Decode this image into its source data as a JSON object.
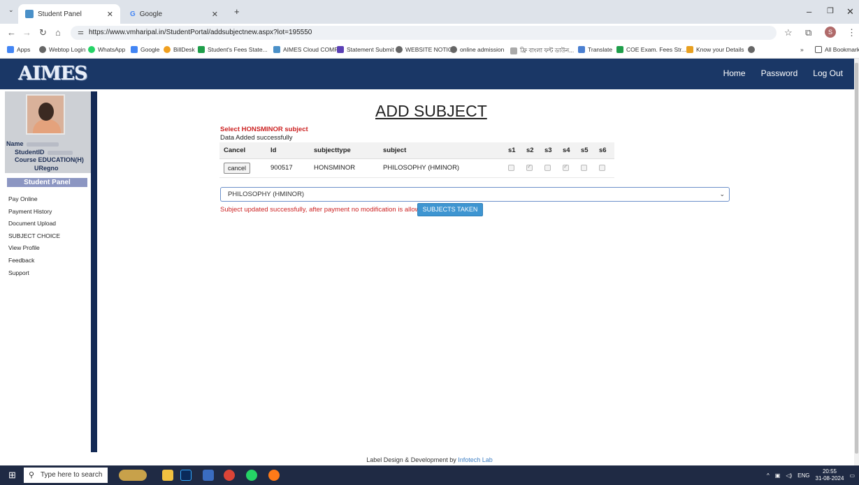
{
  "browser": {
    "tabs": [
      {
        "title": "Student Panel",
        "active": true
      },
      {
        "title": "Google",
        "active": false
      }
    ],
    "new_tab": "+",
    "url": "https://www.vmharipal.in/StudentPortal/addsubjectnew.aspx?lot=195550",
    "bookmarks": [
      "Apps",
      "Webtop Login",
      "WhatsApp",
      "Google",
      "BillDesk",
      "Student's Fees State...",
      "AIMES Cloud COMP...",
      "Statement Submit",
      "WEBSITE NOTICE",
      "online admission",
      "ফ্রি বাংলা ফন্ট ডাউন...",
      "Translate",
      "COE Exam. Fees Str...",
      "Know your Details"
    ],
    "more": "»",
    "all_bookmarks": "All Bookmarks",
    "profile_initial": "S"
  },
  "site": {
    "logo": "AIMES",
    "nav": [
      "Home",
      "Password",
      "Log Out"
    ]
  },
  "sidebar": {
    "name_label": "Name",
    "student_id_label": "StudentID",
    "course_label": "Course",
    "course_value": "EDUCATION(H)",
    "uregno_label": "URegno",
    "panel_title": "Student Panel",
    "menu": [
      "Pay Online",
      "Payment History",
      "Document Upload",
      "SUBJECT CHOICE",
      "View Profile",
      "Feedback",
      "Support"
    ]
  },
  "main": {
    "title": "ADD SUBJECT",
    "select_label": "Select HONSMINOR subject",
    "added_message": "Data Added successfully",
    "table": {
      "headers": [
        "Cancel",
        "Id",
        "subjecttype",
        "subject",
        "s1",
        "s2",
        "s3",
        "s4",
        "s5",
        "s6"
      ],
      "rows": [
        {
          "cancel_label": "cancel",
          "id": "900517",
          "subjecttype": "HONSMINOR",
          "subject": "PHILOSOPHY (HMINOR)",
          "semesters": [
            false,
            true,
            false,
            true,
            false,
            false
          ]
        }
      ]
    },
    "dropdown_value": "PHILOSOPHY (HMINOR)",
    "update_message": "Subject updated successfully, after payment no modification is allowed",
    "subjects_taken_label": "SUBJECTS TAKEN"
  },
  "footer": {
    "text": "Label  Design & Development by ",
    "link": "Infotech Lab"
  },
  "taskbar": {
    "search_placeholder": "Type here to search",
    "lang": "ENG",
    "time": "20:55",
    "date": "31-08-2024"
  }
}
